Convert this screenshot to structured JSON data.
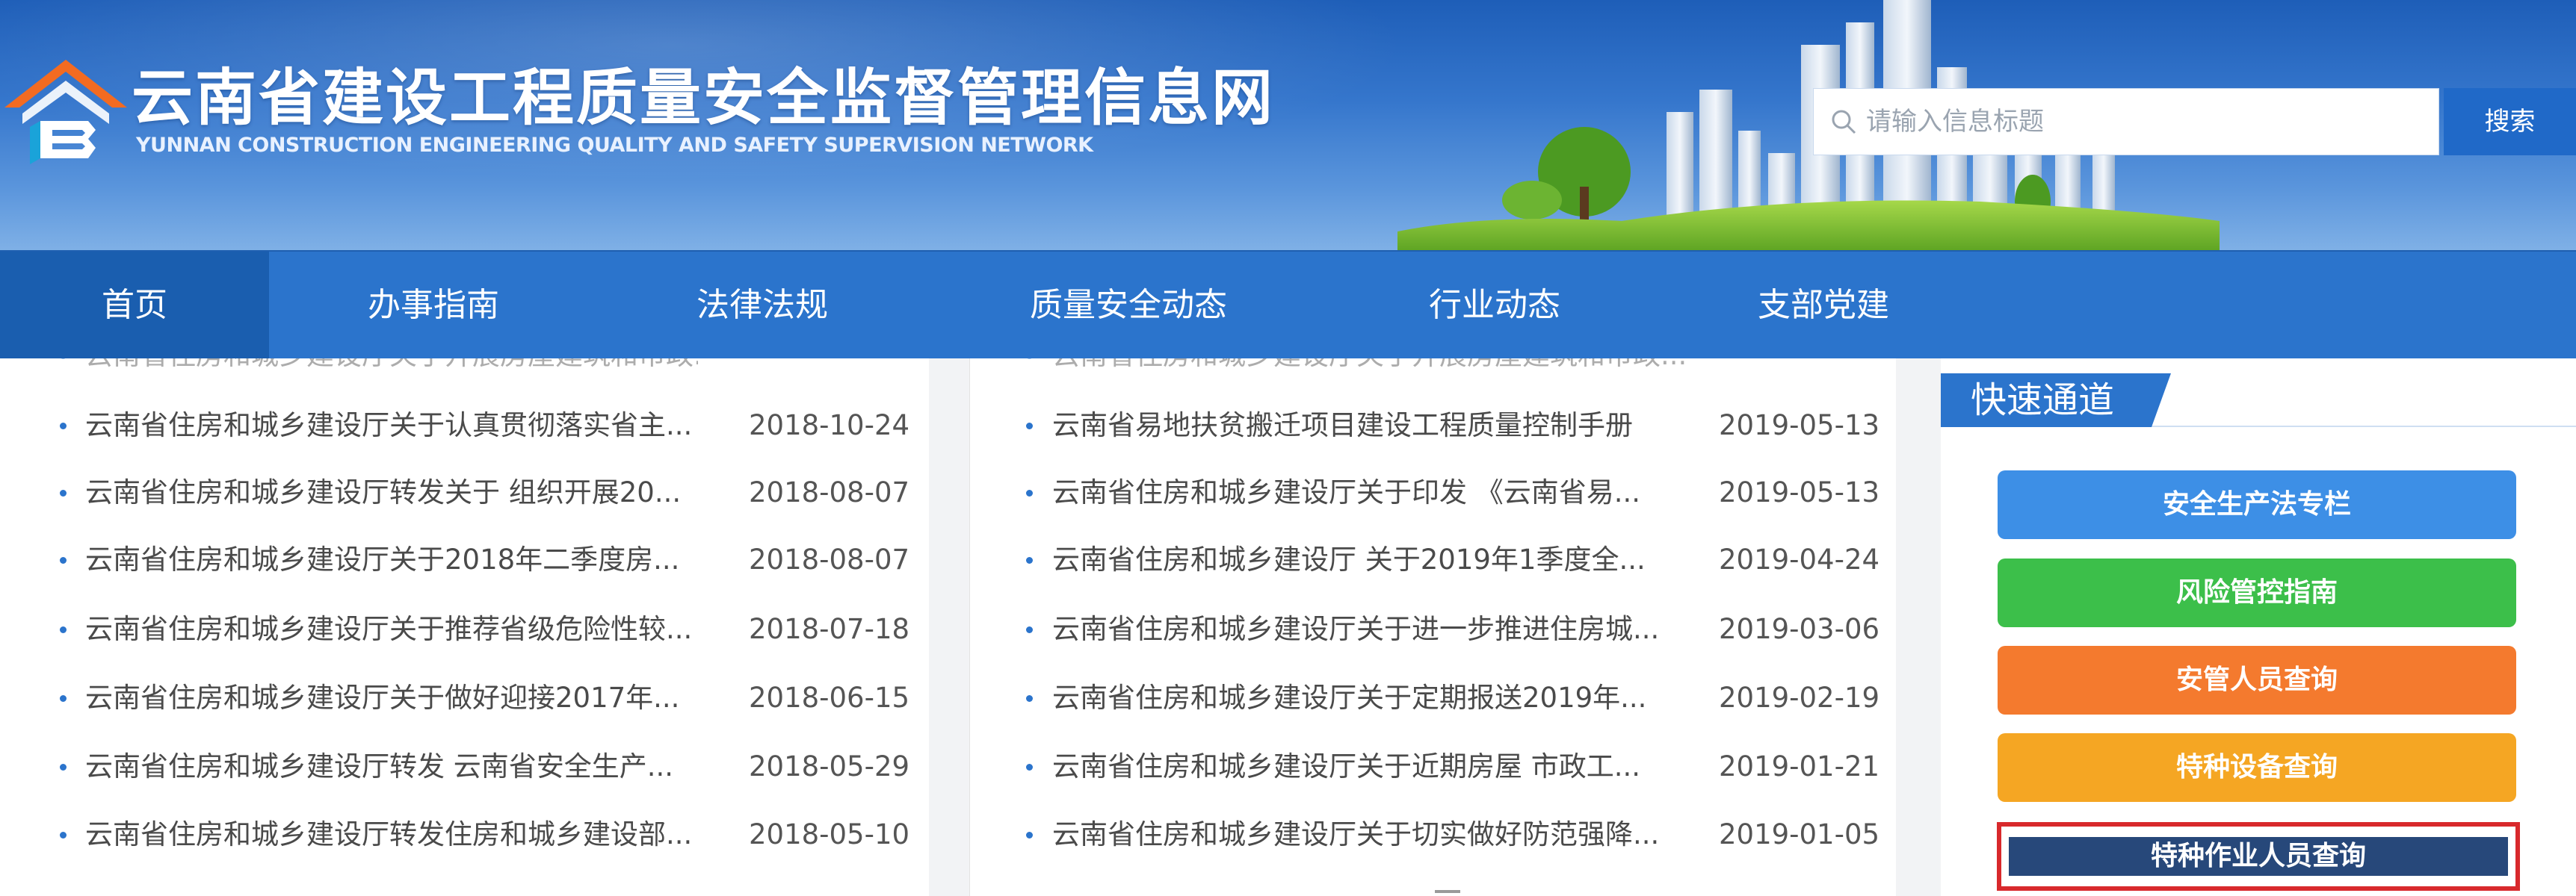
{
  "header": {
    "title_cn": "云南省建设工程质量安全监督管理信息网",
    "title_en": "YUNNAN CONSTRUCTION ENGINEERING QUALITY AND SAFETY SUPERVISION NETWORK"
  },
  "search": {
    "placeholder": "请输入信息标题",
    "value": "",
    "button_label": "搜索"
  },
  "nav": {
    "items": [
      {
        "label": "首页",
        "active": true
      },
      {
        "label": "办事指南"
      },
      {
        "label": "法律法规"
      },
      {
        "label": "质量安全动态"
      },
      {
        "label": "行业动态"
      },
      {
        "label": "支部党建"
      }
    ]
  },
  "list_left": {
    "items": [
      {
        "title": "云南省住房和城乡建设厅关于认真贯彻落实省主...",
        "date": "2018-10-24"
      },
      {
        "title": "云南省住房和城乡建设厅转发关于 组织开展20...",
        "date": "2018-08-07"
      },
      {
        "title": "云南省住房和城乡建设厅关于2018年二季度房...",
        "date": "2018-08-07"
      },
      {
        "title": "云南省住房和城乡建设厅关于推荐省级危险性较...",
        "date": "2018-07-18"
      },
      {
        "title": "云南省住房和城乡建设厅关于做好迎接2017年...",
        "date": "2018-06-15"
      },
      {
        "title": "云南省住房和城乡建设厅转发 云南省安全生产...",
        "date": "2018-05-29"
      },
      {
        "title": "云南省住房和城乡建设厅转发住房和城乡建设部...",
        "date": "2018-05-10"
      }
    ]
  },
  "list_mid": {
    "items": [
      {
        "title": "云南省易地扶贫搬迁项目建设工程质量控制手册",
        "date": "2019-05-13"
      },
      {
        "title": "云南省住房和城乡建设厅关于印发 《云南省易...",
        "date": "2019-05-13"
      },
      {
        "title": "云南省住房和城乡建设厅 关于2019年1季度全...",
        "date": "2019-04-24"
      },
      {
        "title": "云南省住房和城乡建设厅关于进一步推进住房城...",
        "date": "2019-03-06"
      },
      {
        "title": "云南省住房和城乡建设厅关于定期报送2019年...",
        "date": "2019-02-19"
      },
      {
        "title": "云南省住房和城乡建设厅关于近期房屋 市政工...",
        "date": "2019-01-21"
      },
      {
        "title": "云南省住房和城乡建设厅关于切实做好防范强降...",
        "date": "2019-01-05"
      }
    ]
  },
  "quick": {
    "title": "快速通道",
    "buttons": [
      {
        "label": "安全生产法专栏",
        "color": "#3d8fe6"
      },
      {
        "label": "风险管控指南",
        "color": "#3cbf4a"
      },
      {
        "label": "安管人员查询",
        "color": "#f47a2e"
      },
      {
        "label": "特种设备查询",
        "color": "#f5a623"
      },
      {
        "label": "特种作业人员查询",
        "color": "#27487a",
        "highlighted": true
      }
    ]
  },
  "colors": {
    "nav_bg": "#2b74cc",
    "nav_active": "#1a5eaf",
    "highlight_border": "#d8292c"
  }
}
